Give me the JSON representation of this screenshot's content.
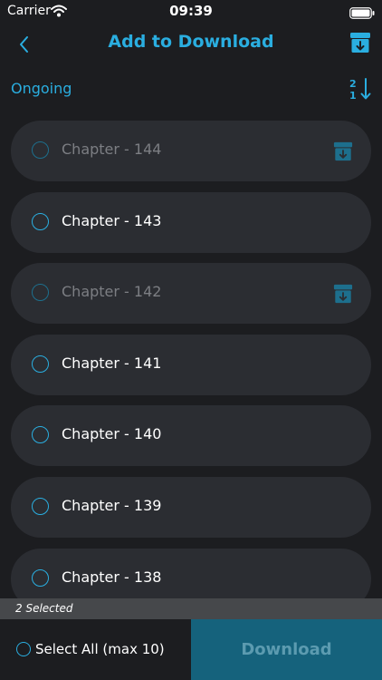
{
  "status_bar": {
    "carrier": "Carrier",
    "time": "09:39"
  },
  "nav": {
    "title": "Add to Download"
  },
  "section": {
    "title": "Ongoing",
    "sort_top_digit": "2",
    "sort_bottom_digit": "1"
  },
  "chapters": [
    {
      "label": "Chapter - 144",
      "downloaded": true
    },
    {
      "label": "Chapter - 143",
      "downloaded": false
    },
    {
      "label": "Chapter - 142",
      "downloaded": true
    },
    {
      "label": "Chapter - 141",
      "downloaded": false
    },
    {
      "label": "Chapter - 140",
      "downloaded": false
    },
    {
      "label": "Chapter - 139",
      "downloaded": false
    },
    {
      "label": "Chapter - 138",
      "downloaded": false
    }
  ],
  "selection": {
    "count_text": "2 Selected"
  },
  "bottom": {
    "select_all_label": "Select All (max 10)",
    "download_label": "Download"
  },
  "colors": {
    "accent": "#2aaee0",
    "background": "#1c1d20",
    "row": "#2b2d32",
    "download_button": "#15627c"
  }
}
